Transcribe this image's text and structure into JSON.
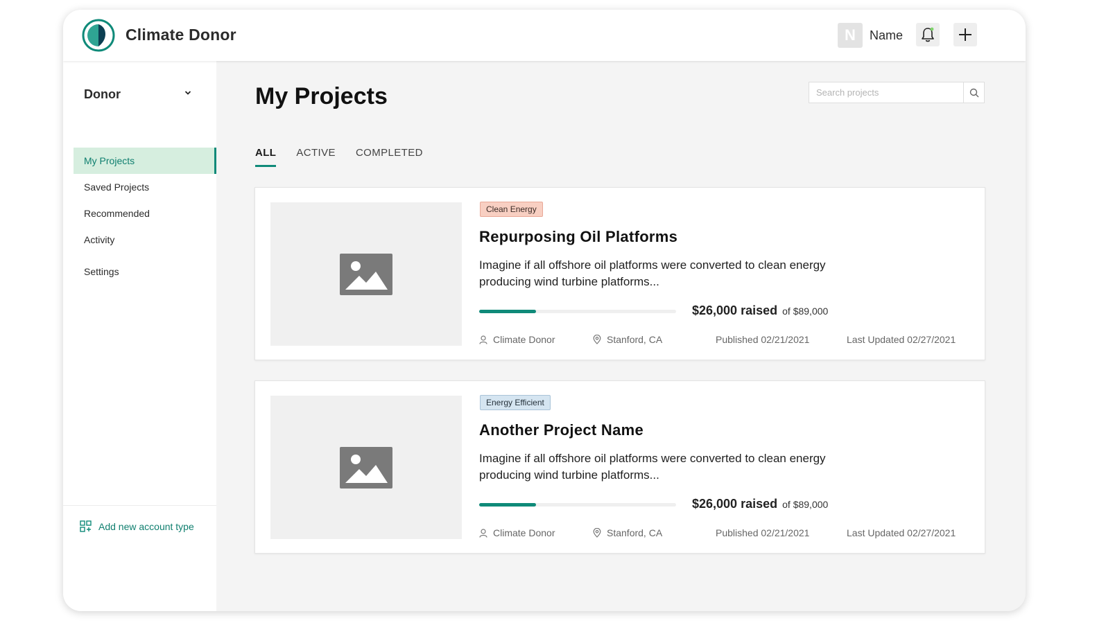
{
  "app": {
    "title": "Climate Donor",
    "logo_icon": "climate-donor-logo"
  },
  "header": {
    "avatar_initial": "N",
    "user_name": "Name",
    "notification_icon": "bell-icon",
    "add_icon": "plus-icon"
  },
  "sidebar": {
    "account_type": "Donor",
    "items": [
      {
        "label": "My Projects",
        "active": true
      },
      {
        "label": "Saved Projects",
        "active": false
      },
      {
        "label": "Recommended",
        "active": false
      },
      {
        "label": "Activity",
        "active": false
      },
      {
        "label": "Settings",
        "active": false
      }
    ],
    "add_account_label": "Add new account type"
  },
  "main": {
    "title": "My Projects",
    "search_placeholder": "Search projects",
    "tabs": [
      {
        "label": "ALL",
        "active": true
      },
      {
        "label": "ACTIVE",
        "active": false
      },
      {
        "label": "COMPLETED",
        "active": false
      }
    ],
    "projects": [
      {
        "tag": "Clean Energy",
        "title": "Repurposing Oil Platforms",
        "description": "Imagine if all offshore oil platforms were converted to clean energy producing wind turbine platforms...",
        "raised_label": "$26,000 raised",
        "goal_label": "of $89,000",
        "progress_fraction": 0.29,
        "author": "Climate Donor",
        "location": "Stanford, CA",
        "published": "Published 02/21/2021",
        "updated": "Last Updated 02/27/2021"
      },
      {
        "tag": "Energy Efficient",
        "title": "Another Project Name",
        "description": "Imagine if all offshore oil platforms were converted to clean energy producing wind turbine platforms...",
        "raised_label": "$26,000 raised",
        "goal_label": "of $89,000",
        "progress_fraction": 0.29,
        "author": "Climate Donor",
        "location": "Stanford, CA",
        "published": "Published 02/21/2021",
        "updated": "Last Updated 02/27/2021"
      }
    ]
  },
  "colors": {
    "accent": "#0f8a79",
    "active_nav_bg": "#d6eedf",
    "clean_energy_tag": "#f8cfc2",
    "energy_efficient_tag": "#d5e5f1"
  }
}
